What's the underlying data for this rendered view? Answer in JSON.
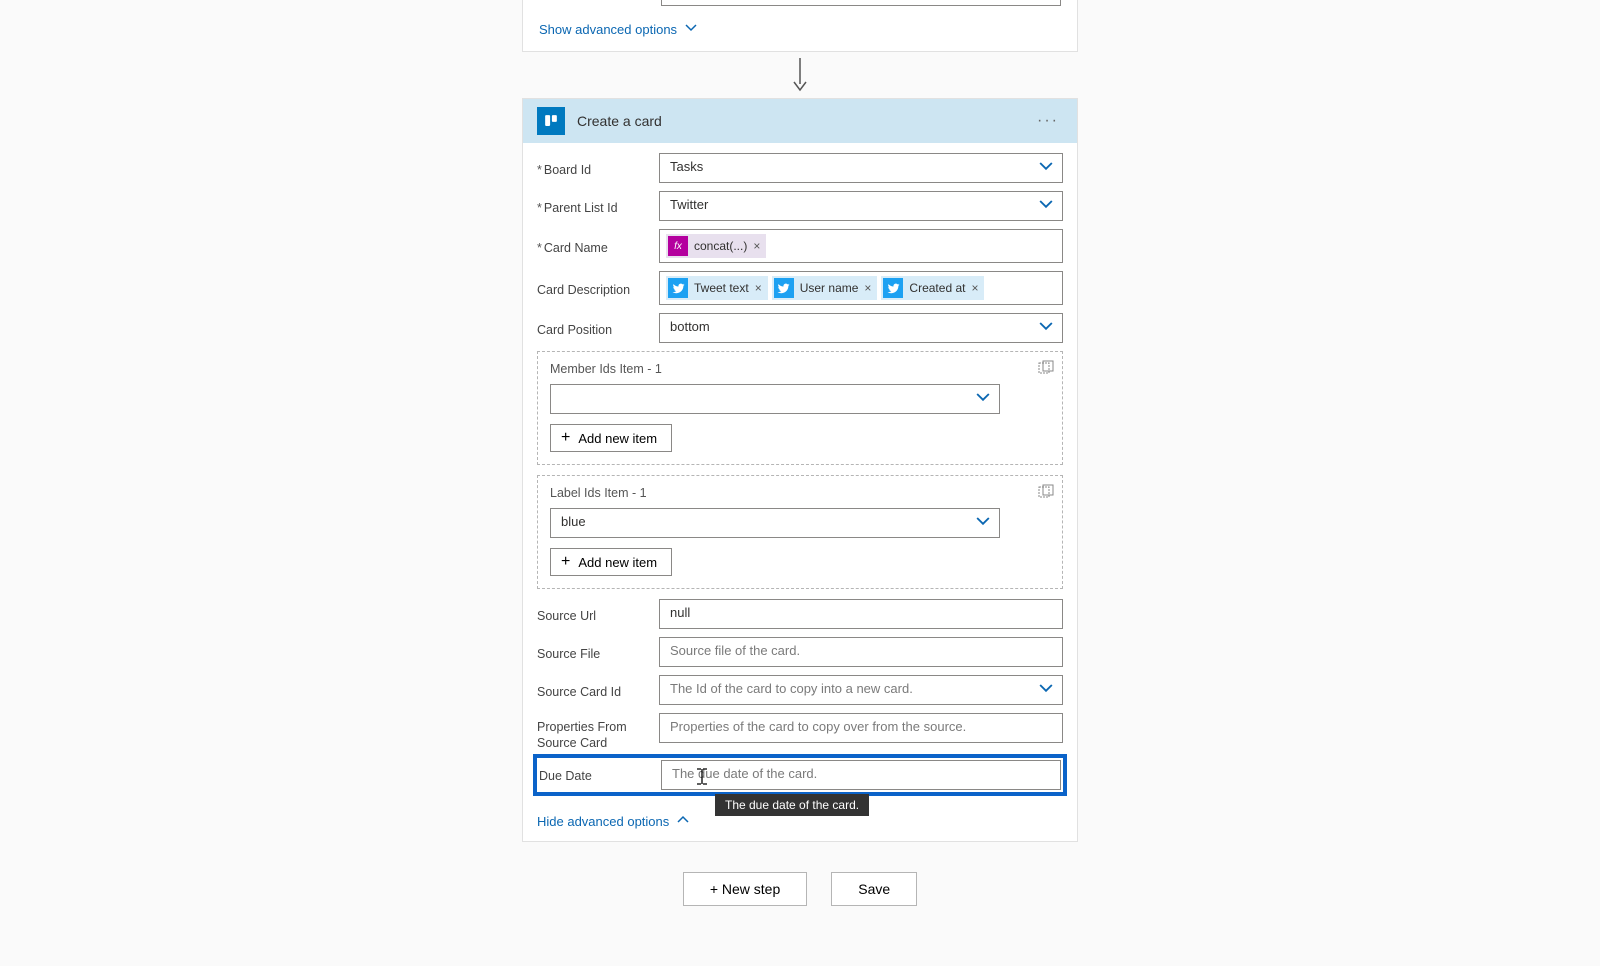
{
  "topCard": {
    "showAdvanced": "Show advanced options"
  },
  "step": {
    "title": "Create a card",
    "fields": {
      "boardId": {
        "label": "Board Id",
        "value": "Tasks"
      },
      "parentListId": {
        "label": "Parent List Id",
        "value": "Twitter"
      },
      "cardName": {
        "label": "Card Name",
        "token": "concat(...)"
      },
      "cardDescription": {
        "label": "Card Description",
        "tokens": [
          "Tweet text",
          "User name",
          "Created at"
        ]
      },
      "cardPosition": {
        "label": "Card Position",
        "value": "bottom"
      },
      "memberIds": {
        "label": "Member Ids Item - 1",
        "addLabel": "Add new item"
      },
      "labelIds": {
        "label": "Label Ids Item - 1",
        "value": "blue",
        "addLabel": "Add new item"
      },
      "sourceUrl": {
        "label": "Source Url",
        "value": "null"
      },
      "sourceFile": {
        "label": "Source File",
        "placeholder": "Source file of the card."
      },
      "sourceCardId": {
        "label": "Source Card Id",
        "placeholder": "The Id of the card to copy into a new card."
      },
      "propsFromSource": {
        "label": "Properties From Source Card",
        "placeholder": "Properties of the card to copy over from the source."
      },
      "dueDate": {
        "label": "Due Date",
        "placeholder": "The due date of the card.",
        "tooltip": "The due date of the card."
      }
    },
    "hideAdvanced": "Hide advanced options"
  },
  "footer": {
    "newStep": "+ New step",
    "save": "Save"
  }
}
